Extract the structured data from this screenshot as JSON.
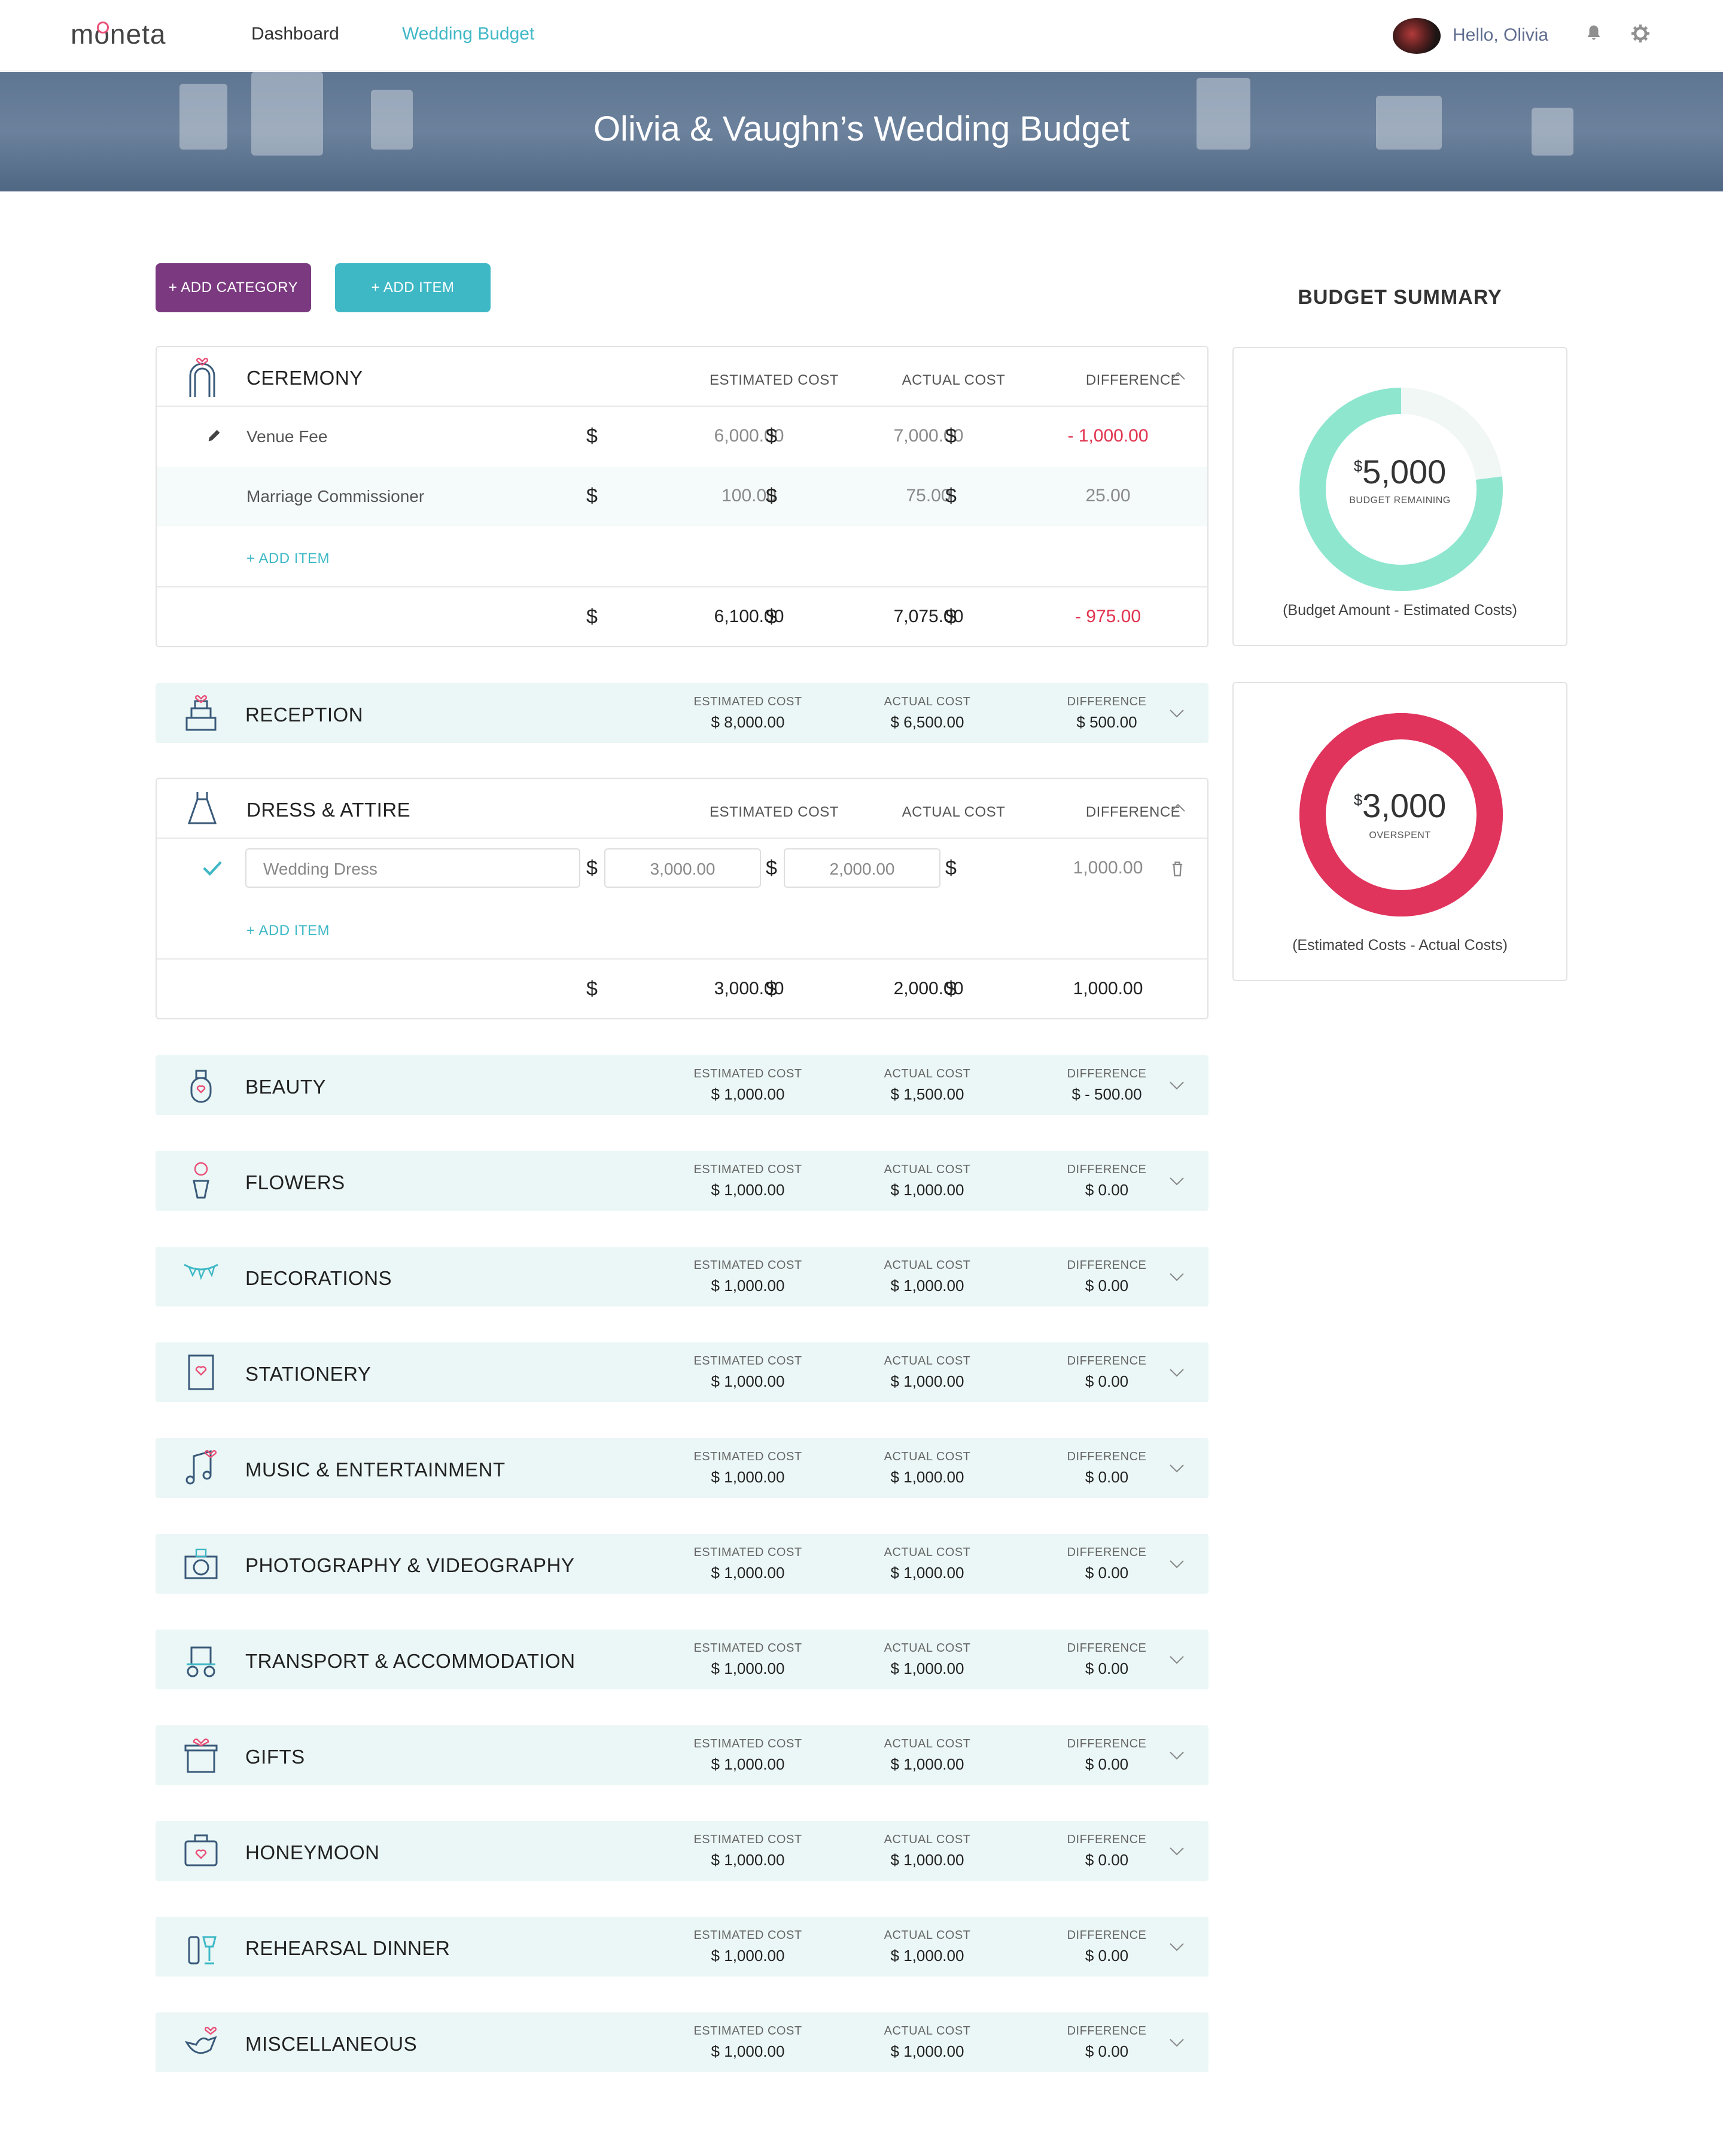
{
  "nav": {
    "logo": "moneta",
    "links": [
      "Dashboard",
      "Wedding Budget"
    ],
    "greeting": "Hello, Olivia"
  },
  "hero": {
    "title": "Olivia & Vaughn’s Wedding Budget"
  },
  "actions": {
    "add_category": "+ ADD CATEGORY",
    "add_item": "+ ADD ITEM"
  },
  "columns": {
    "estimated": "ESTIMATED COST",
    "actual": "ACTUAL COST",
    "difference": "DIFFERENCE"
  },
  "currency": "$",
  "ceremony": {
    "name": "CEREMONY",
    "items": [
      {
        "name": "Venue Fee",
        "estimated": "6,000.00",
        "actual": "7,000.00",
        "difference": "- 1,000.00"
      },
      {
        "name": "Marriage Commissioner",
        "estimated": "100.00",
        "actual": "75.00",
        "difference": "25.00"
      }
    ],
    "add_item": "+ ADD ITEM",
    "total": {
      "estimated": "6,100.00",
      "actual": "7,075.00",
      "difference": "- 975.00"
    }
  },
  "reception": {
    "name": "RECEPTION",
    "estimated": "$ 8,000.00",
    "actual": "$ 6,500.00",
    "difference": "$ 500.00"
  },
  "dress": {
    "name": "DRESS & ATTIRE",
    "item": {
      "name": "Wedding Dress",
      "estimated": "3,000.00",
      "actual": "2,000.00",
      "difference": "1,000.00"
    },
    "add_item": "+ ADD ITEM",
    "total": {
      "estimated": "3,000.00",
      "actual": "2,000.00",
      "difference": "1,000.00"
    }
  },
  "categories": [
    {
      "name": "BEAUTY",
      "estimated": "$ 1,000.00",
      "actual": "$ 1,500.00",
      "difference": "$ - 500.00",
      "icon": "perfume-icon"
    },
    {
      "name": "FLOWERS",
      "estimated": "$ 1,000.00",
      "actual": "$ 1,000.00",
      "difference": "$ 0.00",
      "icon": "flower-vase-icon"
    },
    {
      "name": "DECORATIONS",
      "estimated": "$ 1,000.00",
      "actual": "$ 1,000.00",
      "difference": "$ 0.00",
      "icon": "bunting-icon"
    },
    {
      "name": "STATIONERY",
      "estimated": "$ 1,000.00",
      "actual": "$ 1,000.00",
      "difference": "$ 0.00",
      "icon": "card-icon"
    },
    {
      "name": "MUSIC & ENTERTAINMENT",
      "estimated": "$ 1,000.00",
      "actual": "$ 1,000.00",
      "difference": "$ 0.00",
      "icon": "music-note-icon"
    },
    {
      "name": "PHOTOGRAPHY & VIDEOGRAPHY",
      "estimated": "$ 1,000.00",
      "actual": "$ 1,000.00",
      "difference": "$ 0.00",
      "icon": "camera-icon"
    },
    {
      "name": "TRANSPORT & ACCOMMODATION",
      "estimated": "$ 1,000.00",
      "actual": "$ 1,000.00",
      "difference": "$ 0.00",
      "icon": "carriage-icon"
    },
    {
      "name": "GIFTS",
      "estimated": "$ 1,000.00",
      "actual": "$ 1,000.00",
      "difference": "$ 0.00",
      "icon": "gift-icon"
    },
    {
      "name": "HONEYMOON",
      "estimated": "$ 1,000.00",
      "actual": "$ 1,000.00",
      "difference": "$ 0.00",
      "icon": "suitcase-icon"
    },
    {
      "name": "REHEARSAL DINNER",
      "estimated": "$ 1,000.00",
      "actual": "$ 1,000.00",
      "difference": "$ 0.00",
      "icon": "wine-icon"
    },
    {
      "name": "MISCELLANEOUS",
      "estimated": "$ 1,000.00",
      "actual": "$ 1,000.00",
      "difference": "$ 0.00",
      "icon": "bird-icon"
    }
  ],
  "summary": {
    "title": "BUDGET SUMMARY",
    "remaining": {
      "currency": "$",
      "value": "5,000",
      "label": "BUDGET REMAINING",
      "note": "(Budget Amount - Estimated Costs)",
      "fraction": 0.77,
      "color": "#8ee6cf",
      "track": "#f1f7f5"
    },
    "overspent": {
      "currency": "$",
      "value": "3,000",
      "label": "OVERSPENT",
      "note": "(Estimated Costs - Actual Costs)",
      "fraction": 1.0,
      "color": "#e0345d"
    }
  },
  "colors": {
    "accent": "#3fb8c6",
    "purple": "#7b3a80",
    "negative": "#e0344f",
    "row_tint": "#ebf7f6"
  }
}
